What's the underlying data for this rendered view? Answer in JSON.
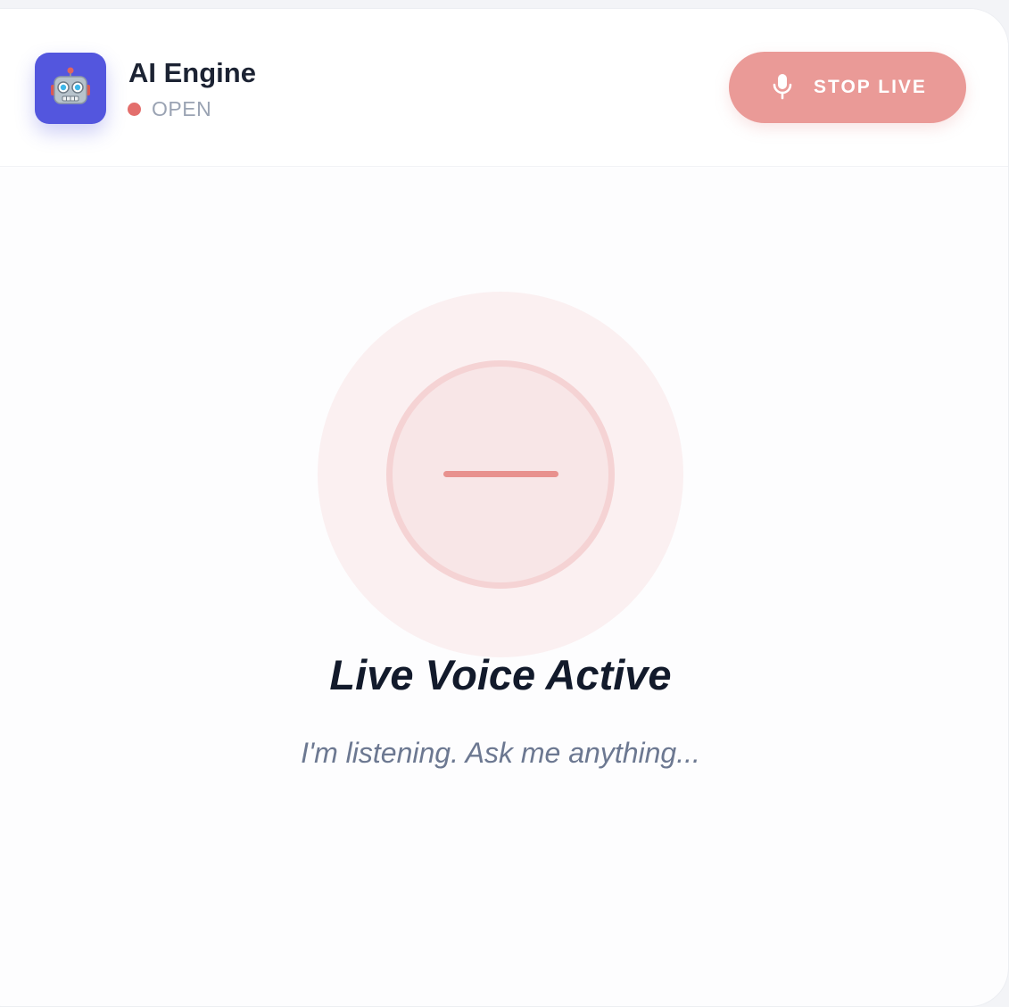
{
  "header": {
    "title": "AI Engine",
    "status": "OPEN",
    "status_color": "#e36e6c",
    "avatar_icon": "robot-face-icon",
    "avatar_color": "#5356de"
  },
  "stop_button": {
    "label": "STOP LIVE",
    "icon": "microphone-icon",
    "background": "#ea9a97"
  },
  "voice": {
    "title": "Live Voice Active",
    "subtitle": "I'm listening. Ask me anything...",
    "indicator_color": "#e8918e"
  }
}
